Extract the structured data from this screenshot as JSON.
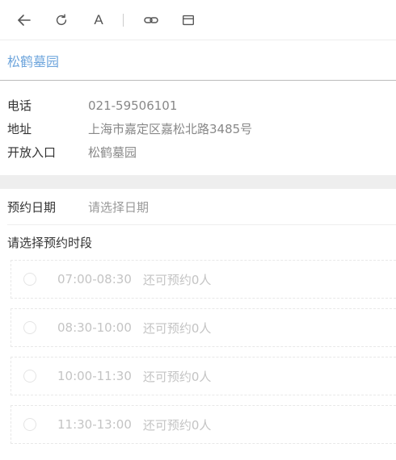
{
  "place": {
    "title": "松鹤墓园"
  },
  "info": [
    {
      "label": "电话",
      "value": "021-59506101"
    },
    {
      "label": "地址",
      "value": "上海市嘉定区嘉松北路3485号"
    },
    {
      "label": "开放入口",
      "value": "松鹤墓园"
    }
  ],
  "booking": {
    "date_label": "预约日期",
    "date_placeholder": "请选择日期",
    "slot_title": "请选择预约时段",
    "slots": [
      {
        "time": "07:00-08:30",
        "remain": "还可预约0人"
      },
      {
        "time": "08:30-10:00",
        "remain": "还可预约0人"
      },
      {
        "time": "10:00-11:30",
        "remain": "还可预约0人"
      },
      {
        "time": "11:30-13:00",
        "remain": "还可预约0人"
      }
    ]
  },
  "toolbar": {
    "font_label": "A",
    "icons": [
      "back-arrow-icon",
      "refresh-icon",
      "font-size-icon",
      "link-icon",
      "window-icon"
    ]
  },
  "colors": {
    "accent": "#6ea5dc",
    "label": "#333333",
    "value": "#888888",
    "disabled": "#c4c4c4",
    "section_gap": "#eeeeee"
  }
}
